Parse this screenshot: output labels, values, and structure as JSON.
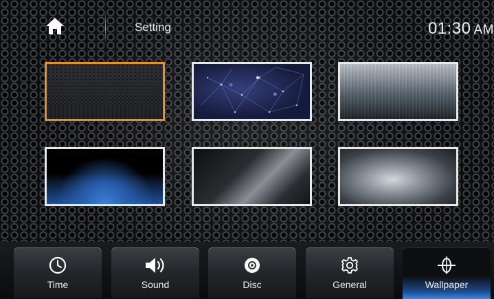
{
  "header": {
    "title": "Setting",
    "clock_time": "01:30",
    "clock_ampm": "AM",
    "home_icon": "home-icon"
  },
  "wallpapers": {
    "selected_index": 0,
    "items": [
      "dark-hex",
      "blue-network",
      "brushed-silver",
      "blue-hex-floor",
      "dark-brushed",
      "silver-radial"
    ]
  },
  "tabs": [
    {
      "label": "Time",
      "icon": "clock-icon"
    },
    {
      "label": "Sound",
      "icon": "speaker-icon"
    },
    {
      "label": "Disc",
      "icon": "disc-icon"
    },
    {
      "label": "General",
      "icon": "gear-icon"
    },
    {
      "label": "Wallpaper",
      "icon": "wallpaper-icon",
      "active": true
    }
  ],
  "colors": {
    "selection_border": "#e8921f",
    "active_tab_glow": "#3e86e6"
  }
}
